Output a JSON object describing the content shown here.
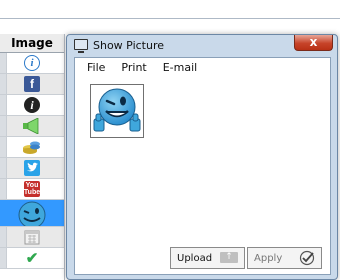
{
  "list": {
    "header": "Image",
    "rows": [
      {
        "icon": "info-icon"
      },
      {
        "icon": "facebook-icon",
        "glyph": "f"
      },
      {
        "icon": "info-dark-icon",
        "glyph": "i"
      },
      {
        "icon": "speaker-icon"
      },
      {
        "icon": "database-icon"
      },
      {
        "icon": "twitter-icon"
      },
      {
        "icon": "youtube-icon",
        "glyph_top": "You",
        "glyph_bottom": "Tube"
      },
      {
        "icon": "winking-smiley-icon",
        "selected": true
      },
      {
        "icon": "calendar-icon"
      },
      {
        "icon": "checkmark-icon",
        "glyph": "✔"
      }
    ]
  },
  "dialog": {
    "title": "Show Picture",
    "close_glyph": "x",
    "menu": [
      "File",
      "Print",
      "E-mail"
    ],
    "picture": {
      "icon": "winking-smiley-thumbs-up-icon"
    },
    "buttons": {
      "upload_label": "Upload",
      "apply_label": "Apply"
    }
  },
  "colors": {
    "selection": "#3399ff",
    "dialog_frame": "#c9d9ea",
    "close_button": "#c7442a",
    "smiley": "#3fa7dc"
  }
}
